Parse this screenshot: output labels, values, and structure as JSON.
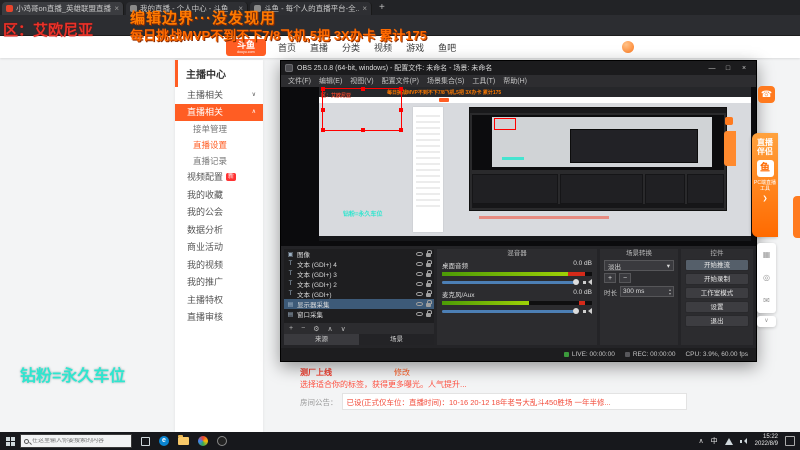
{
  "browser": {
    "tabs": [
      {
        "title": "小鸡哥on直播_英雄联盟直播..."
      },
      {
        "title": "我的直播 - 个人中心 - 斗鱼"
      },
      {
        "title": "斗鱼 - 每个人的直播平台-全..."
      }
    ],
    "new_tab_glyph": "+",
    "close_glyph": "×"
  },
  "overlay": {
    "region": "区：艾欧尼亚",
    "line1": "编辑边界···没发现用",
    "line2": "每日挑战MVP不到不下7/8飞机,5把 3X办卡 累计175",
    "diamond_fan": "钻粉=永久车位"
  },
  "douyu": {
    "logo": "斗鱼",
    "logo_sub": "douyu.com",
    "nav": [
      "首页",
      "直播",
      "分类",
      "视频",
      "游戏",
      "鱼吧"
    ]
  },
  "sidebar": {
    "title": "主播中心",
    "group_anchor": "主播相关",
    "group_live": "直播相关",
    "live_children": [
      "接单管理",
      "直播设置",
      "直播记录"
    ],
    "items": [
      "视频配置",
      "我的收藏",
      "我的公会",
      "数据分析",
      "商业活动",
      "我的视频",
      "我的推广",
      "主播特权",
      "直播审核"
    ],
    "badge_new": "新"
  },
  "obs": {
    "title": "OBS 25.0.8 (64-bit, windows) - 配置文件: 未命名 - 场景: 未命名",
    "menu": [
      "文件(F)",
      "编辑(E)",
      "视图(V)",
      "配置文件(P)",
      "场景集合(S)",
      "工具(T)",
      "帮助(H)"
    ],
    "preview_text": "钻粉=永久车位",
    "sources": {
      "rows": [
        "图像",
        "文本 (GDI+) 4",
        "文本 (GDI+) 3",
        "文本 (GDI+) 2",
        "文本 (GDI+)",
        "显示器采集",
        "窗口采集"
      ],
      "tabs": [
        "来源",
        "场景"
      ]
    },
    "mixer": {
      "title": "混音器",
      "channels": [
        {
          "name": "桌面音频",
          "db": "0.0 dB"
        },
        {
          "name": "麦克风/Aux",
          "db": "0.0 dB"
        }
      ]
    },
    "transitions": {
      "title": "场景转换",
      "selected": "淡出",
      "duration_label": "时长",
      "duration": "300 ms"
    },
    "controls": {
      "title": "控件",
      "buttons": [
        "开始推流",
        "开始录制",
        "工作室模式",
        "设置",
        "退出"
      ]
    },
    "status": {
      "live": "LIVE: 00:00:00",
      "rec": "REC: 00:00:00",
      "cpu": "CPU: 3.9%, 60.00 fps"
    }
  },
  "page": {
    "room_title": "测厂上线",
    "edit_link": "修改",
    "tag_tip": "选择适合你的标签，获得更多曝光。人气提升...",
    "notice_label": "房间公告：",
    "notice_text": "已设(正式仅车位：直播时间)：10-16 20-12 18年老号大乱斗450胜场 一年半修..."
  },
  "widgets": {
    "service_glyph": "☎",
    "companion_title": "直播伴侣",
    "companion_logo": "鱼",
    "companion_sub": "PC端直播工具",
    "arrow_glyph": "❯",
    "tool_glyphs": [
      "▦",
      "◎",
      "✉"
    ],
    "more_glyph": "∨"
  },
  "taskbar": {
    "search_placeholder": "在这里输入你要搜索的内容",
    "ime": "中",
    "tray_chevron": "∧",
    "time": "15:22",
    "date": "2022/8/9"
  },
  "glyphs": {
    "plus": "+",
    "minus": "−",
    "gear": "⚙",
    "up": "∧",
    "down": "∨",
    "dropdown": "▾",
    "chev_down": "∨",
    "chev_up": "∧",
    "win_min": "—",
    "win_max": "□",
    "win_close": "×",
    "spin_up": "▴",
    "spin_down": "▾",
    "text_source": "T",
    "image_source": "▣",
    "display_source": "▤"
  },
  "colors": {
    "douyu_orange": "#ff5d23",
    "overlay_orange": "#ff7a00",
    "overlay_red": "#e8332a",
    "overlay_cyan": "#2ee6cf",
    "selection_red": "#ff0000"
  }
}
